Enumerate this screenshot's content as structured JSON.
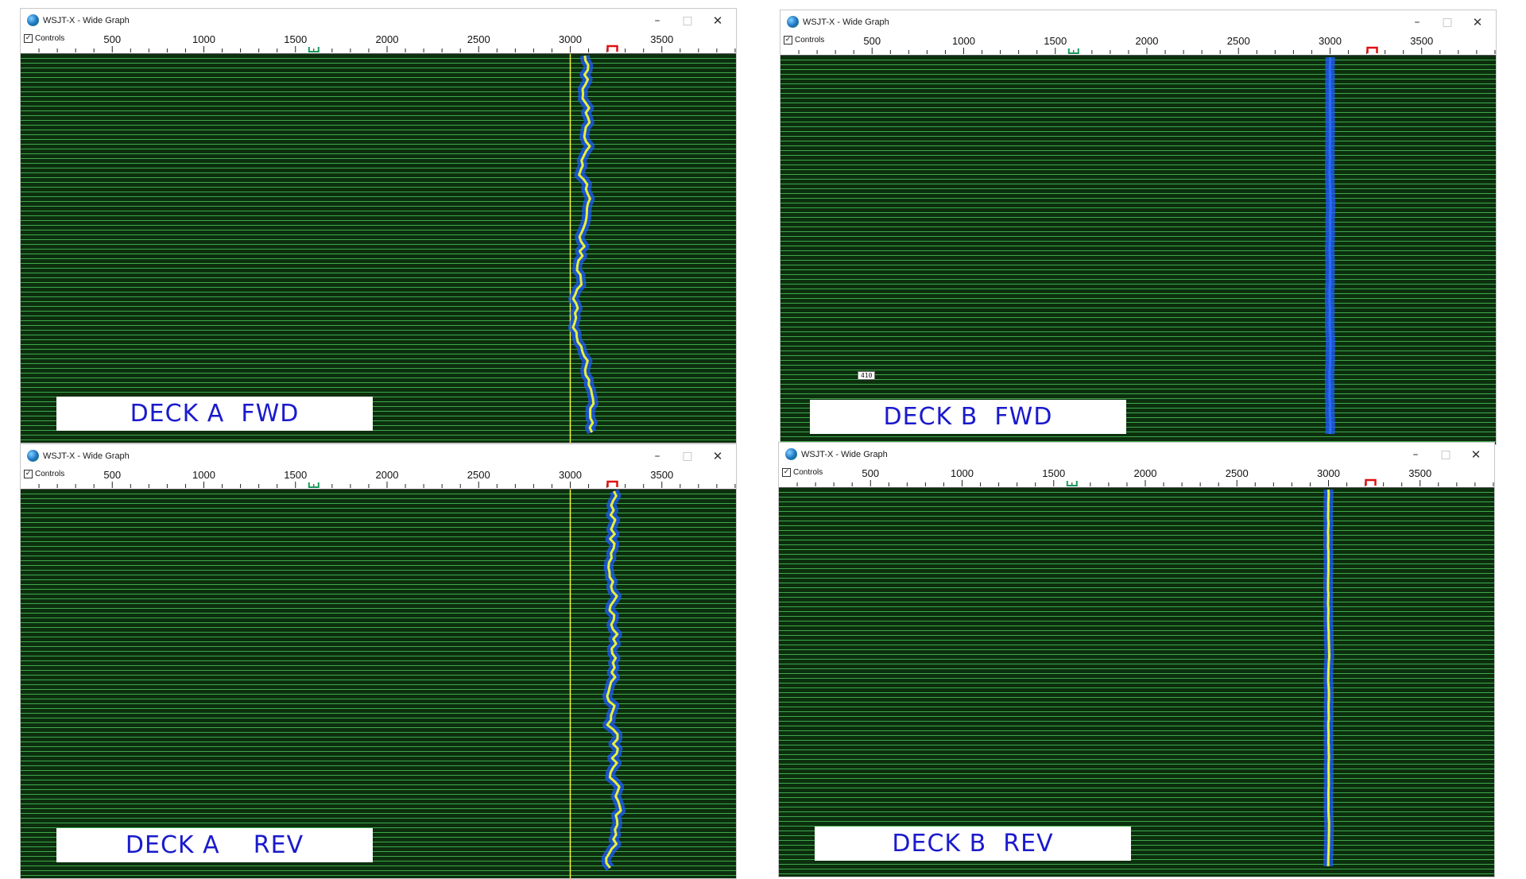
{
  "windows": [
    {
      "id": "a-fwd",
      "title": "WSJT-X - Wide Graph",
      "controls_label": "Controls",
      "controls_checked": true,
      "scale_labels": [
        "500",
        "1000",
        "1500",
        "2000",
        "2500",
        "3000",
        "3500"
      ],
      "scale_values": [
        500,
        1000,
        1500,
        2000,
        2500,
        3000,
        3500
      ],
      "rx_marker_hz": 1600,
      "tx_marker_hz": 3230,
      "cursor_line_hz": 3000,
      "trace_center_hz": 3070,
      "trace_wobble_hz": 45,
      "trace_color": "#e8ef3a",
      "label": "DECK A  FWD"
    },
    {
      "id": "b-fwd",
      "title": "WSJT-X - Wide Graph",
      "controls_label": "Controls",
      "controls_checked": true,
      "scale_labels": [
        "500",
        "1000",
        "1500",
        "2000",
        "2500",
        "3000",
        "3500"
      ],
      "scale_values": [
        500,
        1000,
        1500,
        2000,
        2500,
        3000,
        3500
      ],
      "rx_marker_hz": 1600,
      "tx_marker_hz": 3230,
      "trace_center_hz": 3000,
      "trace_wobble_hz": 4,
      "trace_color": "#2a6bff",
      "small_tag": "410",
      "label": "DECK B  FWD"
    },
    {
      "id": "a-rev",
      "title": "WSJT-X - Wide Graph",
      "controls_label": "Controls",
      "controls_checked": true,
      "scale_labels": [
        "500",
        "1000",
        "1500",
        "2000",
        "2500",
        "3000",
        "3500"
      ],
      "scale_values": [
        500,
        1000,
        1500,
        2000,
        2500,
        3000,
        3500
      ],
      "rx_marker_hz": 1600,
      "tx_marker_hz": 3230,
      "cursor_line_hz": 3000,
      "trace_center_hz": 3240,
      "trace_wobble_hz": 55,
      "trace_color": "#e8ef3a",
      "label": "DECK A    REV"
    },
    {
      "id": "b-rev",
      "title": "WSJT-X - Wide Graph",
      "controls_label": "Controls",
      "controls_checked": true,
      "scale_labels": [
        "500",
        "1000",
        "1500",
        "2000",
        "2500",
        "3000",
        "3500"
      ],
      "scale_values": [
        500,
        1000,
        1500,
        2000,
        2500,
        3000,
        3500
      ],
      "rx_marker_hz": 1600,
      "tx_marker_hz": 3230,
      "trace_center_hz": 3000,
      "trace_wobble_hz": 4,
      "trace_color": "#e8ef3a",
      "label": "DECK B  REV"
    }
  ],
  "colors": {
    "waterfall_bg": "#0c2f0e",
    "scan_line": "#3fa84a",
    "signal_halo": "#1e5cff",
    "cursor_line": "#f4f43a",
    "rx_marker": "#1a9a5a",
    "tx_marker": "#e01010",
    "label_text": "#1a1acc"
  },
  "icons": {
    "app": "wsjtx-globe-icon",
    "minimize": "minimize-icon",
    "maximize": "maximize-icon",
    "close": "close-icon"
  }
}
